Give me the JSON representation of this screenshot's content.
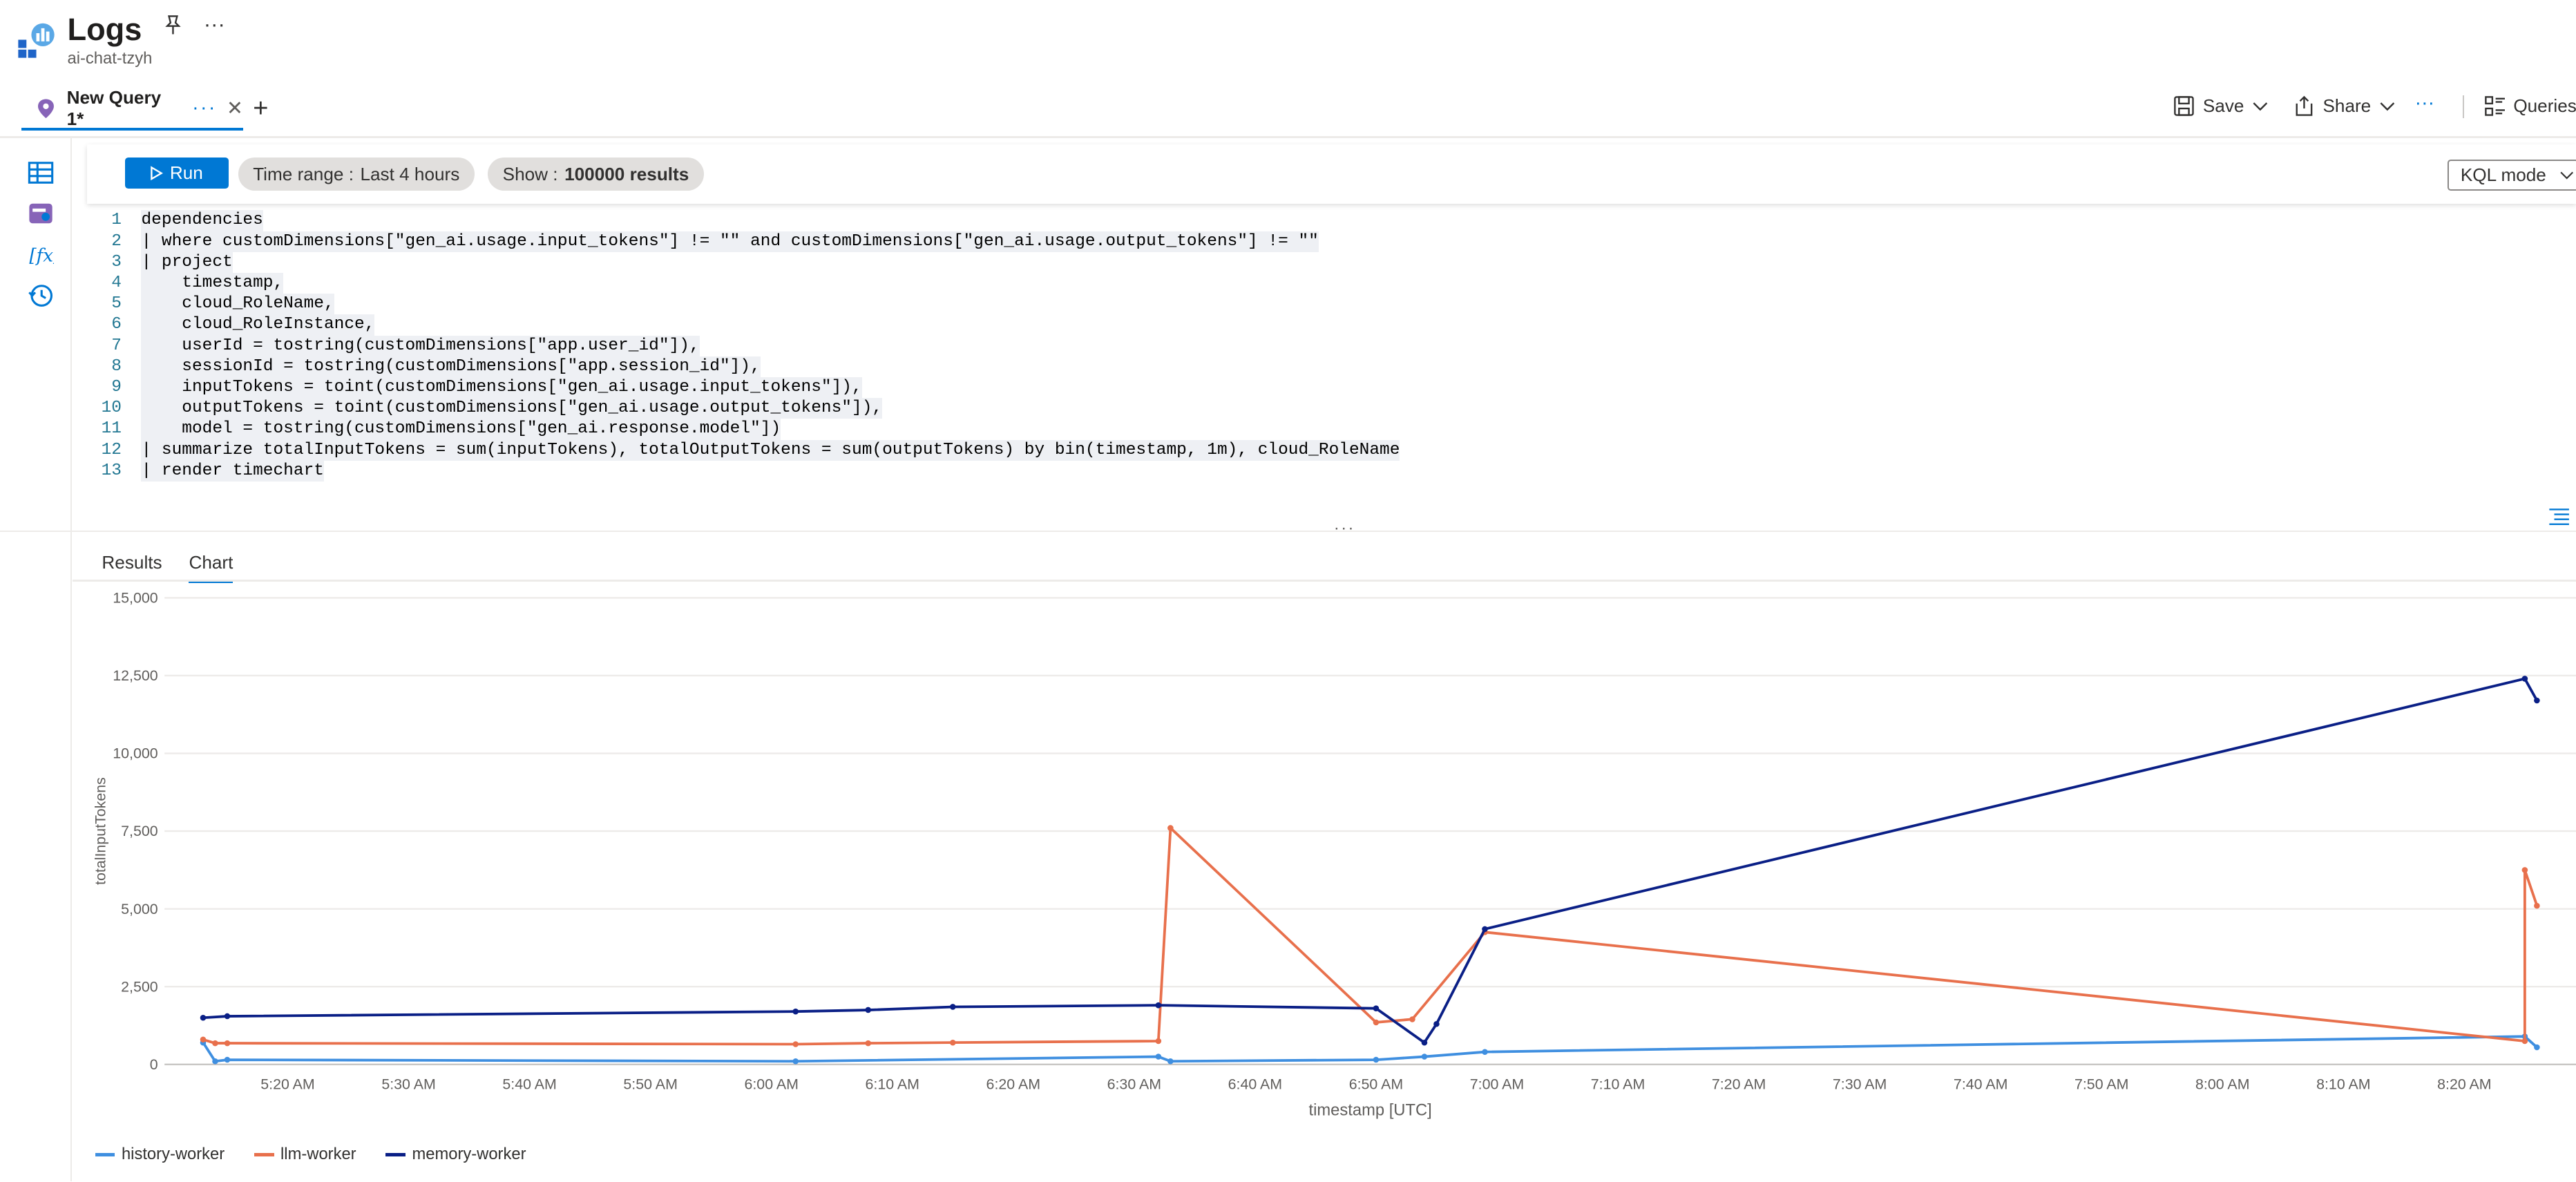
{
  "header": {
    "title": "Logs",
    "subtitle": "ai-chat-tzyh",
    "more_label": "···"
  },
  "tabs": [
    {
      "label": "New Query 1*",
      "more": "···",
      "close": "✕"
    }
  ],
  "add_tab_label": "+",
  "toolbar": {
    "save_label": "Save",
    "share_label": "Share",
    "more_label": "···",
    "queries_label": "Queries"
  },
  "query_toolbar": {
    "run_label": "Run",
    "time_range_label": "Time range :",
    "time_range_value": "Last 4 hours",
    "show_label": "Show :",
    "show_value": "100000 results",
    "mode_label": "KQL mode"
  },
  "editor": {
    "lines": [
      "dependencies",
      "| where customDimensions[\"gen_ai.usage.input_tokens\"] != \"\" and customDimensions[\"gen_ai.usage.output_tokens\"] != \"\"",
      "| project",
      "    timestamp,",
      "    cloud_RoleName,",
      "    cloud_RoleInstance,",
      "    userId = tostring(customDimensions[\"app.user_id\"]),",
      "    sessionId = tostring(customDimensions[\"app.session_id\"]),",
      "    inputTokens = toint(customDimensions[\"gen_ai.usage.input_tokens\"]),",
      "    outputTokens = toint(customDimensions[\"gen_ai.usage.output_tokens\"]),",
      "    model = tostring(customDimensions[\"gen_ai.response.model\"])",
      "| summarize totalInputTokens = sum(inputTokens), totalOutputTokens = sum(outputTokens) by bin(timestamp, 1m), cloud_RoleName",
      "| render timechart"
    ]
  },
  "results_tabs": [
    "Results",
    "Chart"
  ],
  "active_results_tab": "Chart",
  "colors": {
    "accent": "#0078d4",
    "history-worker": "#3f8fe0",
    "llm-worker": "#e8704c",
    "memory-worker": "#0a1f86"
  },
  "icons": [
    "app-logo-icon",
    "pin-icon",
    "more-icon",
    "query-pin-icon",
    "close-icon",
    "add-icon",
    "save-icon",
    "chevron-down-icon",
    "share-icon",
    "queries-icon",
    "tables-icon",
    "queries-pack-icon",
    "functions-icon",
    "history-icon",
    "play-icon",
    "format-icon"
  ],
  "chart_data": {
    "type": "line",
    "xlabel": "timestamp [UTC]",
    "ylabel": "totalInputTokens",
    "ylim": [
      0,
      15000
    ],
    "yticks": [
      0,
      2500,
      5000,
      7500,
      10000,
      12500,
      15000
    ],
    "ytick_labels": [
      "0",
      "2,500",
      "5,000",
      "7,500",
      "10,000",
      "12,500",
      "15,000"
    ],
    "xlim": [
      "5:13 AM",
      "8:26 AM"
    ],
    "xticks": [
      "5:20 AM",
      "5:30 AM",
      "5:40 AM",
      "5:50 AM",
      "6:00 AM",
      "6:10 AM",
      "6:20 AM",
      "6:30 AM",
      "6:40 AM",
      "6:50 AM",
      "7:00 AM",
      "7:10 AM",
      "7:20 AM",
      "7:30 AM",
      "7:40 AM",
      "7:50 AM",
      "8:00 AM",
      "8:10 AM",
      "8:20 AM"
    ],
    "grid": true,
    "legend_position": "bottom-left",
    "series": [
      {
        "name": "history-worker",
        "x": [
          "5:13 AM",
          "5:14 AM",
          "5:15 AM",
          "6:02 AM",
          "6:32 AM",
          "6:33 AM",
          "6:50 AM",
          "6:54 AM",
          "6:59 AM",
          "8:25 AM",
          "8:26 AM"
        ],
        "values": [
          700,
          100,
          150,
          100,
          250,
          100,
          150,
          250,
          400,
          900,
          550
        ]
      },
      {
        "name": "llm-worker",
        "x": [
          "5:13 AM",
          "5:14 AM",
          "5:15 AM",
          "6:02 AM",
          "6:08 AM",
          "6:15 AM",
          "6:32 AM",
          "6:33 AM",
          "6:50 AM",
          "6:53 AM",
          "6:59 AM",
          "8:25 AM",
          "8:25 AM",
          "8:26 AM"
        ],
        "values": [
          800,
          680,
          680,
          650,
          680,
          700,
          750,
          7600,
          1350,
          1450,
          4250,
          750,
          6250,
          5100
        ]
      },
      {
        "name": "memory-worker",
        "x": [
          "5:13 AM",
          "5:15 AM",
          "6:02 AM",
          "6:08 AM",
          "6:15 AM",
          "6:32 AM",
          "6:50 AM",
          "6:54 AM",
          "6:55 AM",
          "6:59 AM",
          "8:25 AM",
          "8:26 AM"
        ],
        "values": [
          1500,
          1550,
          1700,
          1750,
          1850,
          1900,
          1800,
          700,
          1300,
          4350,
          12400,
          11700
        ]
      }
    ]
  }
}
